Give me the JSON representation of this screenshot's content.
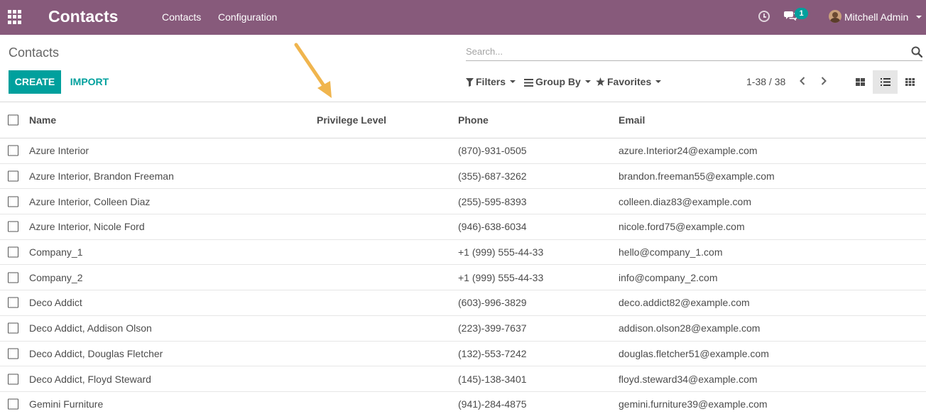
{
  "navbar": {
    "app_title": "Contacts",
    "menu": [
      "Contacts",
      "Configuration"
    ],
    "chat_badge": "1",
    "user_name": "Mitchell Admin",
    "color": "#875a7b"
  },
  "control_panel": {
    "breadcrumb": "Contacts",
    "create_label": "CREATE",
    "import_label": "IMPORT",
    "search_placeholder": "Search...",
    "filters_label": "Filters",
    "group_by_label": "Group By",
    "favorites_label": "Favorites",
    "pager": "1-38 / 38",
    "accent_color": "#00a09d",
    "active_view": "list-view"
  },
  "list": {
    "columns": [
      "Name",
      "Privilege Level",
      "Phone",
      "Email"
    ],
    "rows": [
      {
        "name": "Azure Interior",
        "privilege": "",
        "phone": "(870)-931-0505",
        "email": "azure.Interior24@example.com"
      },
      {
        "name": "Azure Interior, Brandon Freeman",
        "privilege": "",
        "phone": "(355)-687-3262",
        "email": "brandon.freeman55@example.com"
      },
      {
        "name": "Azure Interior, Colleen Diaz",
        "privilege": "",
        "phone": "(255)-595-8393",
        "email": "colleen.diaz83@example.com"
      },
      {
        "name": "Azure Interior, Nicole Ford",
        "privilege": "",
        "phone": "(946)-638-6034",
        "email": "nicole.ford75@example.com"
      },
      {
        "name": "Company_1",
        "privilege": "",
        "phone": "+1 (999) 555-44-33",
        "email": "hello@company_1.com"
      },
      {
        "name": "Company_2",
        "privilege": "",
        "phone": "+1 (999) 555-44-33",
        "email": "info@company_2.com"
      },
      {
        "name": "Deco Addict",
        "privilege": "",
        "phone": "(603)-996-3829",
        "email": "deco.addict82@example.com"
      },
      {
        "name": "Deco Addict, Addison Olson",
        "privilege": "",
        "phone": "(223)-399-7637",
        "email": "addison.olson28@example.com"
      },
      {
        "name": "Deco Addict, Douglas Fletcher",
        "privilege": "",
        "phone": "(132)-553-7242",
        "email": "douglas.fletcher51@example.com"
      },
      {
        "name": "Deco Addict, Floyd Steward",
        "privilege": "",
        "phone": "(145)-138-3401",
        "email": "floyd.steward34@example.com"
      },
      {
        "name": "Gemini Furniture",
        "privilege": "",
        "phone": "(941)-284-4875",
        "email": "gemini.furniture39@example.com"
      }
    ]
  },
  "annotation": {
    "arrow_color": "#f0b54e"
  }
}
